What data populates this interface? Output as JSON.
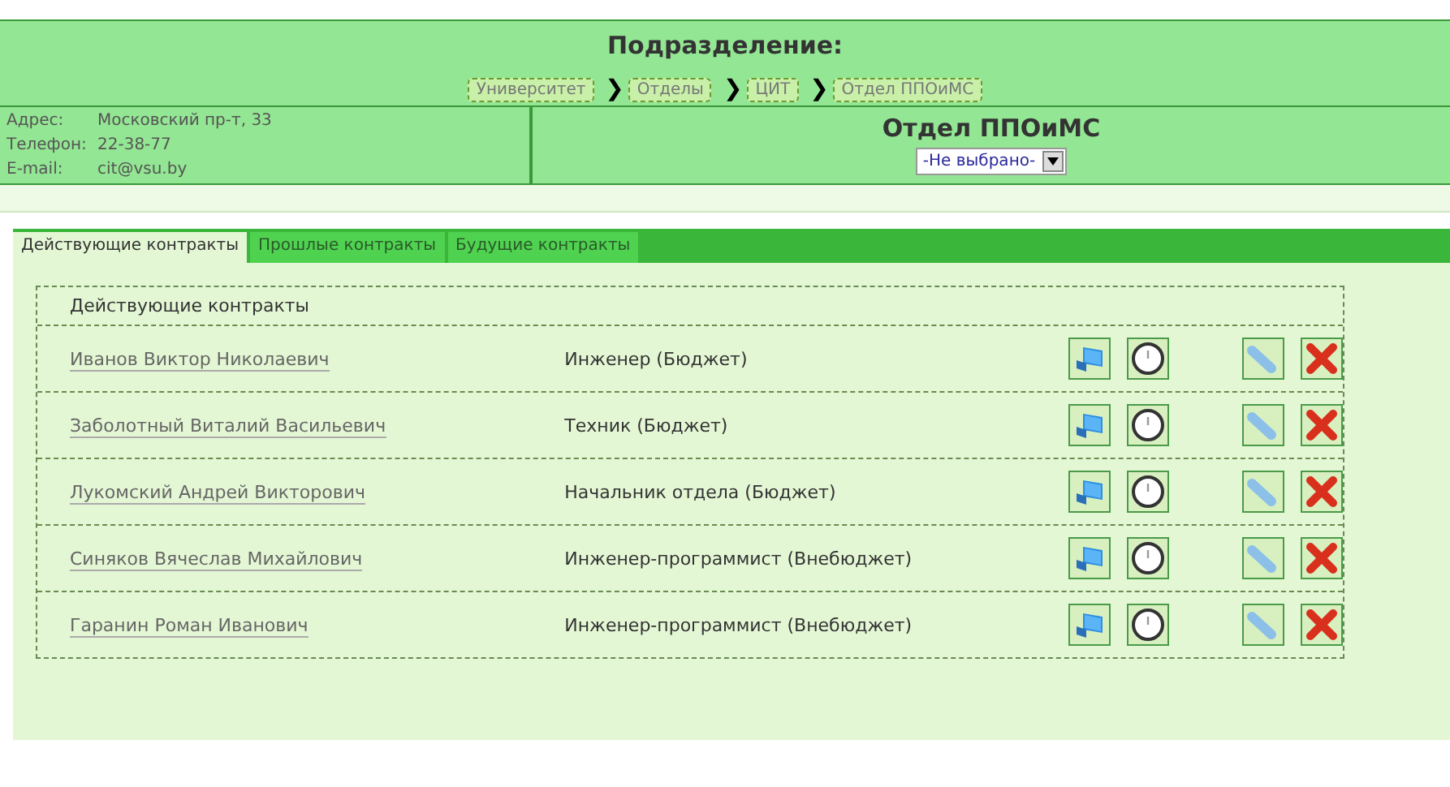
{
  "header": {
    "title": "Подразделение:",
    "breadcrumbs": [
      {
        "label": "Университет"
      },
      {
        "label": "Отделы"
      },
      {
        "label": "ЦИТ"
      },
      {
        "label": "Отдел ППОиМС"
      }
    ],
    "separator": "❯"
  },
  "contacts": [
    {
      "label": "Адрес:",
      "value": "Московский пр-т, 33"
    },
    {
      "label": "Телефон:",
      "value": "22-38-77"
    },
    {
      "label": "E-mail:",
      "value": "cit@vsu.by"
    }
  ],
  "department": {
    "title": "Отдел ППОиМС",
    "select": {
      "value": "-Не выбрано-"
    }
  },
  "tabs": [
    {
      "label": "Действующие контракты",
      "selected": true
    },
    {
      "label": "Прошлые контракты",
      "selected": false
    },
    {
      "label": "Будущие контракты",
      "selected": false
    }
  ],
  "table": {
    "heading": "Действующие контракты",
    "rows": [
      {
        "name": "Иванов Виктор Николаевич",
        "position": "Инженер (Бюджет)"
      },
      {
        "name": "Заболотный Виталий Васильевич",
        "position": "Техник (Бюджет)"
      },
      {
        "name": "Лукомский Андрей Викторович",
        "position": "Начальник отдела (Бюджет)"
      },
      {
        "name": "Синяков Вячеслав Михайлович",
        "position": "Инженер-программист (Внебюджет)"
      },
      {
        "name": "Гаранин Роман Иванович",
        "position": "Инженер-программист (Внебюджет)"
      }
    ]
  }
}
